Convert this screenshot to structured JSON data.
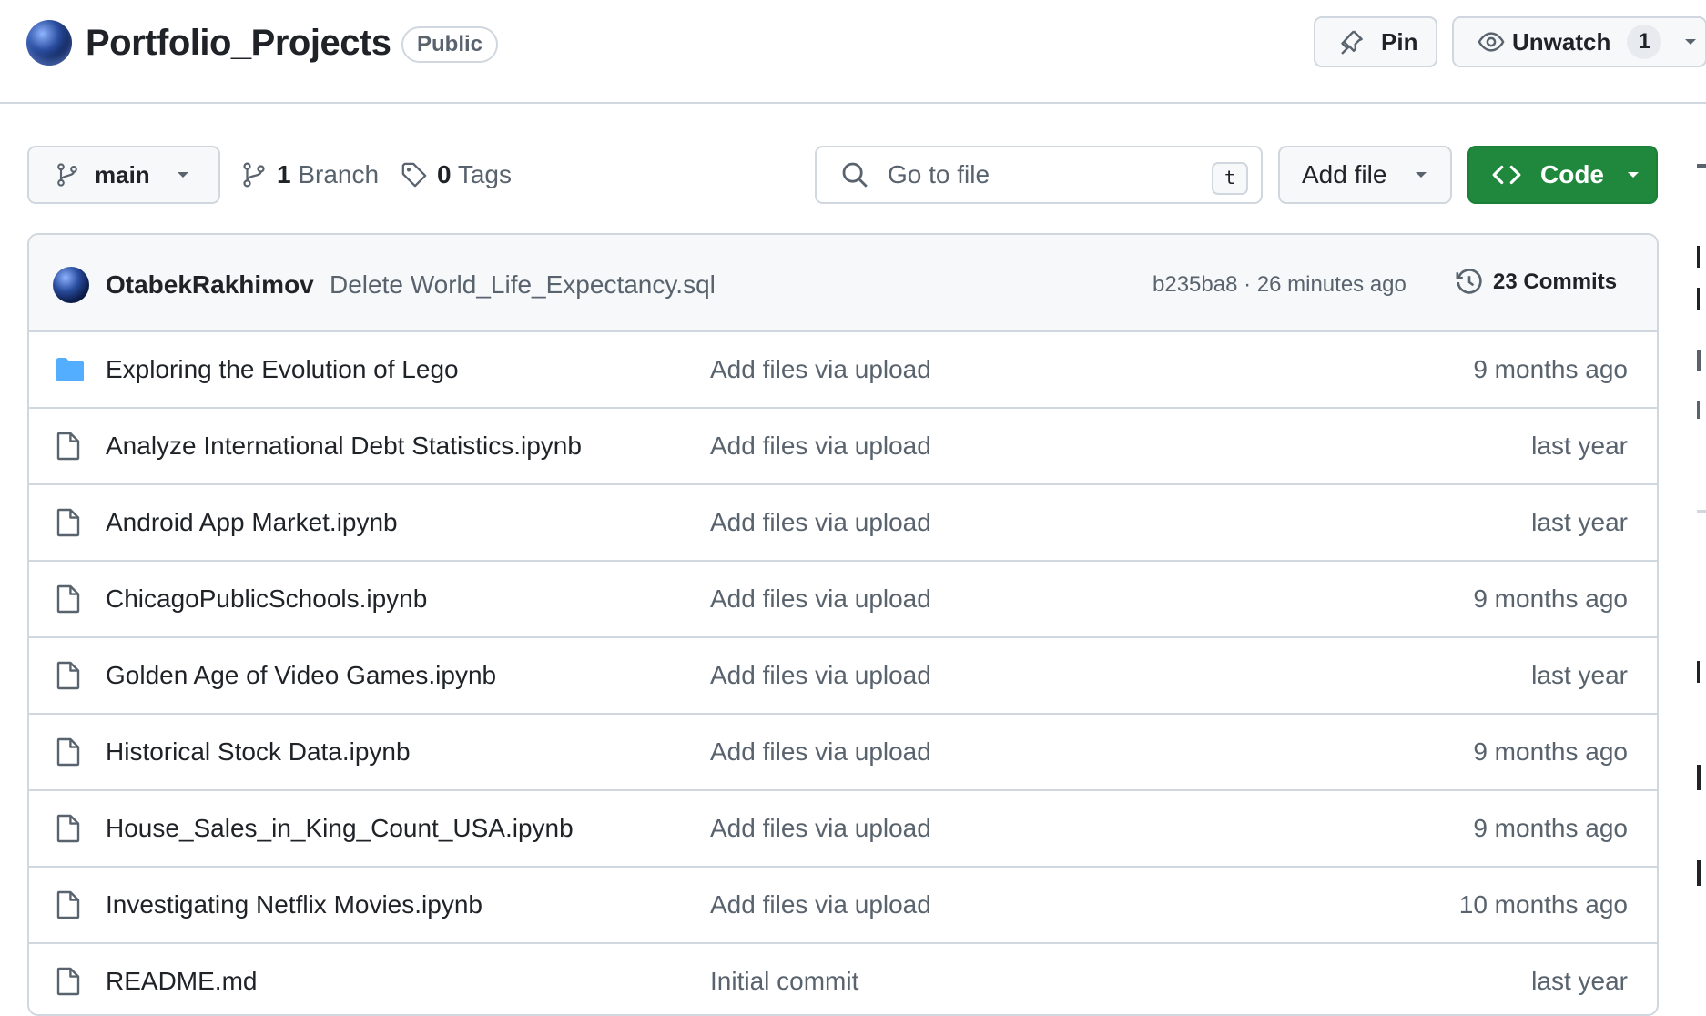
{
  "repo": {
    "name": "Portfolio_Projects",
    "visibility": "Public",
    "pin_label": "Pin",
    "watch_label": "Unwatch",
    "watch_count": "1"
  },
  "toolbar": {
    "branch": "main",
    "branch_count": "1",
    "branch_label": "Branch",
    "tag_count": "0",
    "tag_label": "Tags",
    "search_placeholder": "Go to file",
    "search_shortcut": "t",
    "add_file_label": "Add file",
    "code_label": "Code"
  },
  "latest_commit": {
    "author": "OtabekRakhimov",
    "message": "Delete World_Life_Expectancy.sql",
    "sha_time": "b235ba8 · 26 minutes ago",
    "commits_label": "23 Commits"
  },
  "files": [
    {
      "name": "Exploring the Evolution of Lego",
      "type": "folder",
      "message": "Add files via upload",
      "time": "9 months ago"
    },
    {
      "name": "Analyze International Debt Statistics.ipynb",
      "type": "file",
      "message": "Add files via upload",
      "time": "last year"
    },
    {
      "name": "Android App Market.ipynb",
      "type": "file",
      "message": "Add files via upload",
      "time": "last year"
    },
    {
      "name": "ChicagoPublicSchools.ipynb",
      "type": "file",
      "message": "Add files via upload",
      "time": "9 months ago"
    },
    {
      "name": "Golden Age of Video Games.ipynb",
      "type": "file",
      "message": "Add files via upload",
      "time": "last year"
    },
    {
      "name": "Historical Stock Data.ipynb",
      "type": "file",
      "message": "Add files via upload",
      "time": "9 months ago"
    },
    {
      "name": "House_Sales_in_King_Count_USA.ipynb",
      "type": "file",
      "message": "Add files via upload",
      "time": "9 months ago"
    },
    {
      "name": "Investigating Netflix Movies.ipynb",
      "type": "file",
      "message": "Add files via upload",
      "time": "10 months ago"
    },
    {
      "name": "README.md",
      "type": "file",
      "message": "Initial commit",
      "time": "last year"
    }
  ],
  "colors": {
    "accent_green": "#1f883d",
    "folder_blue": "#54aeff",
    "muted_text": "#59636e",
    "border": "#d0d7de"
  }
}
